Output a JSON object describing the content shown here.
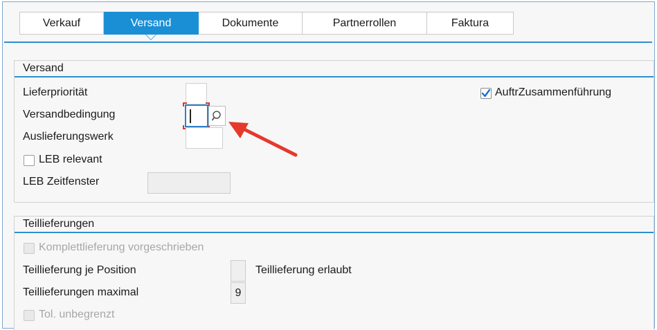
{
  "tabs": [
    {
      "label": "Verkauf",
      "active": false
    },
    {
      "label": "Versand",
      "active": true
    },
    {
      "label": "Dokumente",
      "active": false
    },
    {
      "label": "Partnerrollen",
      "active": false
    },
    {
      "label": "Faktura",
      "active": false
    }
  ],
  "versand": {
    "title": "Versand",
    "lieferprioritaet_label": "Lieferpriorität",
    "versandbedingung_label": "Versandbedingung",
    "auslieferungswerk_label": "Auslieferungswerk",
    "leb_relevant_label": "LEB relevant",
    "leb_zeitfenster_label": "LEB Zeitfenster",
    "auftrzusammenfuehrung_label": "AuftrZusammenführung",
    "auftrzusammenfuehrung_checked": true,
    "leb_relevant_checked": false
  },
  "teillieferungen": {
    "title": "Teillieferungen",
    "komplettlieferung_label": "Komplettlieferung vorgeschrieben",
    "teillieferung_je_position_label": "Teillieferung je Position",
    "teillieferung_erlaubt_label": "Teillieferung erlaubt",
    "teillieferungen_maximal_label": "Teillieferungen maximal",
    "teillieferungen_maximal_value": "9",
    "tol_unbegrenzt_label": "Tol. unbegrenzt"
  },
  "colors": {
    "accent": "#1a8fd6",
    "arrow": "#e5392c",
    "focus_corner": "#e0342b"
  },
  "icons": [
    "search-icon",
    "checkmark-icon",
    "red-arrow-annotation"
  ]
}
